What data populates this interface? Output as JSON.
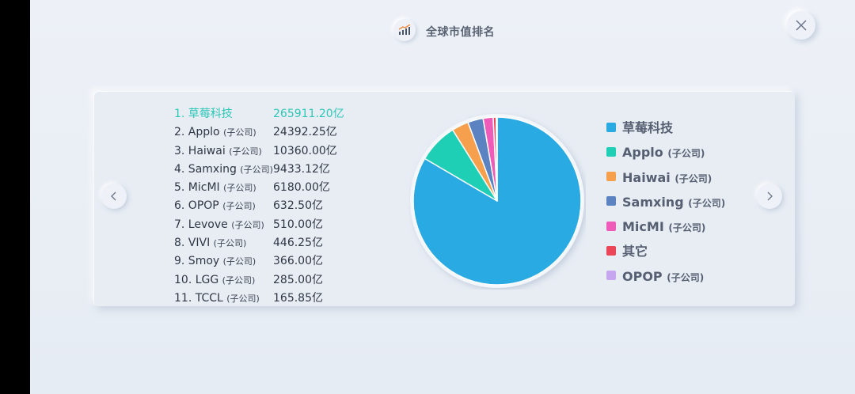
{
  "header": {
    "title": "全球市值排名",
    "icon": "trend-chart-icon"
  },
  "colors": {
    "accent": "#2ec7b7",
    "text": "#2f3644"
  },
  "chart_data": {
    "type": "pie",
    "title": "全球市值排名",
    "unit": "亿",
    "ranking": [
      {
        "rank": "1.",
        "name": "草莓科技",
        "sub": "",
        "value": 265911.2,
        "label": "265911.20亿"
      },
      {
        "rank": "2.",
        "name": "Applo",
        "sub": "(子公司)",
        "value": 24392.25,
        "label": "24392.25亿"
      },
      {
        "rank": "3.",
        "name": "Haiwai",
        "sub": "(子公司)",
        "value": 10360.0,
        "label": "10360.00亿"
      },
      {
        "rank": "4.",
        "name": "Samxing",
        "sub": "(子公司)",
        "value": 9433.12,
        "label": "9433.12亿"
      },
      {
        "rank": "5.",
        "name": "MicMI",
        "sub": "(子公司)",
        "value": 6180.0,
        "label": "6180.00亿"
      },
      {
        "rank": "6.",
        "name": "OPOP",
        "sub": "(子公司)",
        "value": 632.5,
        "label": "632.50亿"
      },
      {
        "rank": "7.",
        "name": "Levove",
        "sub": "(子公司)",
        "value": 510.0,
        "label": "510.00亿"
      },
      {
        "rank": "8.",
        "name": "VIVI",
        "sub": "(子公司)",
        "value": 446.25,
        "label": "446.25亿"
      },
      {
        "rank": "9.",
        "name": "Smoy",
        "sub": "(子公司)",
        "value": 366.0,
        "label": "366.00亿"
      },
      {
        "rank": "10.",
        "name": "LGG",
        "sub": "(子公司)",
        "value": 285.0,
        "label": "285.00亿"
      },
      {
        "rank": "11.",
        "name": "TCCL",
        "sub": "(子公司)",
        "value": 165.85,
        "label": "165.85亿"
      }
    ],
    "slices": [
      {
        "name": "草莓科技",
        "sub": "",
        "value": 265911.2,
        "color": "#29aae2"
      },
      {
        "name": "Applo",
        "sub": "(子公司)",
        "value": 24392.25,
        "color": "#1ecfb5"
      },
      {
        "name": "Haiwai",
        "sub": "(子公司)",
        "value": 10360.0,
        "color": "#f6a04d"
      },
      {
        "name": "Samxing",
        "sub": "(子公司)",
        "value": 9433.12,
        "color": "#5b82c1"
      },
      {
        "name": "MicMI",
        "sub": "(子公司)",
        "value": 6180.0,
        "color": "#ee5bb8"
      },
      {
        "name": "其它",
        "sub": "",
        "value": 1773.1,
        "color": "#ea4658"
      },
      {
        "name": "OPOP",
        "sub": "(子公司)",
        "value": 632.5,
        "color": "#c6a6ee"
      }
    ],
    "legend_position": "right"
  }
}
